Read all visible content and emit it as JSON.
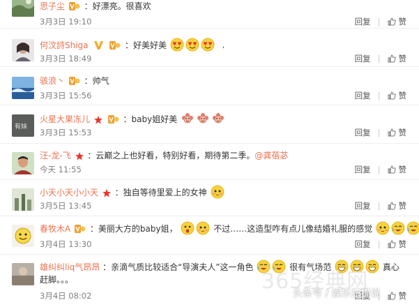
{
  "comments": [
    {
      "user": "思子尘",
      "text": "：好漂亮。很喜欢",
      "time": "3月3日 19:10",
      "reply": "回复",
      "like": "赞"
    },
    {
      "user": "何汶詩Shiga",
      "text": "：好美好美",
      "trail": "،",
      "time": "3月3日 18:49",
      "reply": "回复",
      "like": "赞"
    },
    {
      "user": "骇浪丶",
      "text": "：帅气",
      "time": "3月3日 15:56",
      "reply": "回复",
      "like": "赞"
    },
    {
      "user": "火星大果冻儿",
      "text": "：baby姐好美",
      "time": "3月3日 15:53",
      "reply": "回复",
      "like": "赞"
    },
    {
      "user": "汪-龙-飞",
      "text": "：云巅之上也好看，特别好看，期待第二季。",
      "mention": "@龚蓓苾",
      "time": "今天 11:55",
      "reply": "回复",
      "like": "赞"
    },
    {
      "user": "小天小天小小天",
      "text": "：独自等待里爱上的女神",
      "time": "3月5日 13:45",
      "reply": "回复",
      "like": "赞"
    },
    {
      "user": "春牧木A",
      "text_a": "：美丽大方的baby姐，",
      "text_b": "不过……这造型咋有点儿像结婚礼服的感觉",
      "time": "3月4日 13:30",
      "reply": "回复",
      "like": "赞"
    },
    {
      "user": "雄纠纠liq气昂昂",
      "text_a": "：亲滴气质比较适合“导演夫人”这一角色",
      "text_b": "很有气场范",
      "text_c": "真心",
      "line2": "赶脚。。。",
      "time": "3月4日 08:02",
      "reply": "回复",
      "like": "赞"
    }
  ],
  "watermark": {
    "brand": "365经典网",
    "sub": "头条号 / 娱乐扫描说"
  },
  "colors": {
    "name": "#eb7350",
    "gray": "#808080",
    "border": "#eeeeee"
  }
}
